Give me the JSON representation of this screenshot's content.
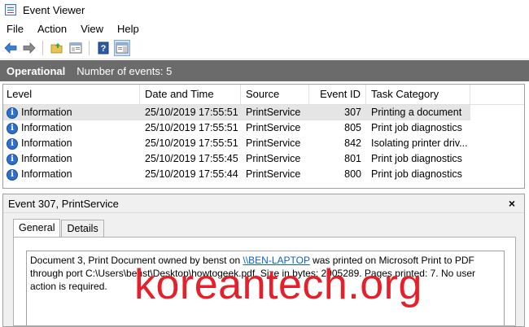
{
  "window": {
    "title": "Event Viewer"
  },
  "menu": [
    "File",
    "Action",
    "View",
    "Help"
  ],
  "toolbar": {
    "icons": [
      "back-arrow-icon",
      "forward-arrow-icon",
      "open-folder-icon",
      "console-tree-icon",
      "help-icon",
      "action-pane-icon"
    ]
  },
  "log_header": {
    "title": "Operational",
    "count": "Number of events: 5"
  },
  "columns": [
    "Level",
    "Date and Time",
    "Source",
    "Event ID",
    "Task Category"
  ],
  "events": [
    {
      "level": "Information",
      "date": "25/10/2019 17:55:51",
      "source": "PrintService",
      "id": "307",
      "task": "Printing a document"
    },
    {
      "level": "Information",
      "date": "25/10/2019 17:55:51",
      "source": "PrintService",
      "id": "805",
      "task": "Print job diagnostics"
    },
    {
      "level": "Information",
      "date": "25/10/2019 17:55:51",
      "source": "PrintService",
      "id": "842",
      "task": "Isolating printer driv..."
    },
    {
      "level": "Information",
      "date": "25/10/2019 17:55:45",
      "source": "PrintService",
      "id": "801",
      "task": "Print job diagnostics"
    },
    {
      "level": "Information",
      "date": "25/10/2019 17:55:44",
      "source": "PrintService",
      "id": "800",
      "task": "Print job diagnostics"
    }
  ],
  "detail": {
    "title": "Event 307, PrintService",
    "close": "×",
    "tabs": [
      "General",
      "Details"
    ],
    "text_before_link": "Document 3, Print Document owned by benst on ",
    "link": "\\\\BEN-LAPTOP",
    "text_after_link": " was printed on Microsoft Print to PDF through port C:\\Users\\benst\\Desktop\\howtogeek.pdf. Size in bytes: 2905289. Pages printed: 7. No user action is required."
  },
  "watermark": "koreantech.org",
  "colors": {
    "header_strip": "#6b6b6b",
    "info_blue": "#2f6fc6",
    "link": "#0a5fcf",
    "watermark": "#e4202a",
    "selected_row": "#e5e5e5"
  }
}
